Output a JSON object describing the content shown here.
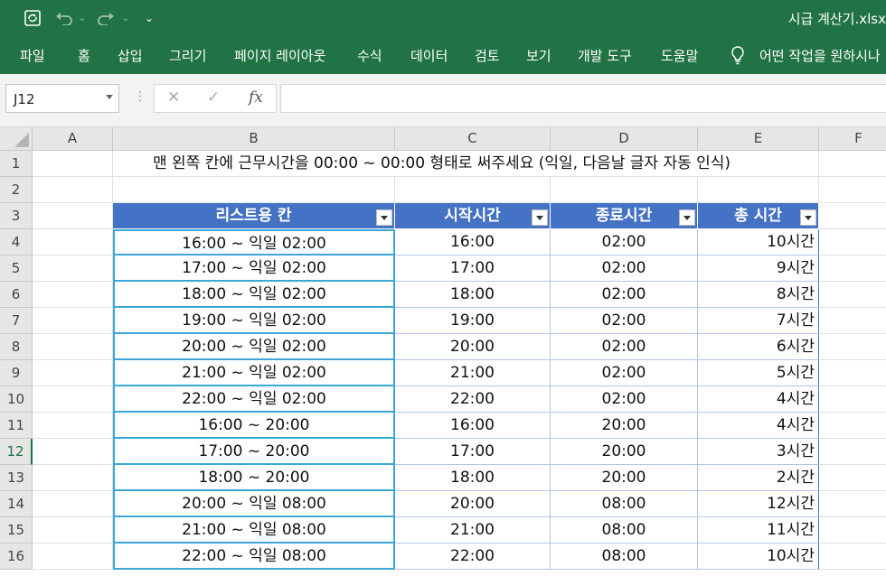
{
  "window": {
    "title": "시급 계산기.xlsx"
  },
  "quick_access": {
    "save_icon": "autosave-sync-icon",
    "undo_icon": "undo-icon",
    "redo_icon": "redo-icon",
    "customize_icon": "customize-qat-icon"
  },
  "ribbon": {
    "tabs": [
      "파일",
      "홈",
      "삽입",
      "그리기",
      "페이지 레이아웃",
      "수식",
      "데이터",
      "검토",
      "보기",
      "개발 도구",
      "도움말"
    ],
    "tell_me": "어떤 작업을 원하시나"
  },
  "formula_bar": {
    "name_box": "J12",
    "cancel_icon": "✕",
    "enter_icon": "✓",
    "fx_label": "fx",
    "formula": ""
  },
  "sheet": {
    "columns": [
      "A",
      "B",
      "C",
      "D",
      "E",
      "F"
    ],
    "rows": [
      "1",
      "2",
      "3",
      "4",
      "5",
      "6",
      "7",
      "8",
      "9",
      "10",
      "11",
      "12",
      "13",
      "14",
      "15",
      "16"
    ],
    "active_row": "12",
    "note": "맨 왼쪽 칸에 근무시간을 00:00 ~ 00:00 형태로 써주세요 (익일, 다음날 글자 자동 인식)",
    "table_headers": [
      "리스트용 칸",
      "시작시간",
      "종료시간",
      "총 시간"
    ],
    "table_header_color": "#4472c4",
    "selection_color": "#3aa7d8",
    "table_rows": [
      [
        "16:00 ~ 익일 02:00",
        "16:00",
        "02:00",
        "10시간"
      ],
      [
        "17:00 ~ 익일 02:00",
        "17:00",
        "02:00",
        "9시간"
      ],
      [
        "18:00 ~ 익일 02:00",
        "18:00",
        "02:00",
        "8시간"
      ],
      [
        "19:00 ~ 익일 02:00",
        "19:00",
        "02:00",
        "7시간"
      ],
      [
        "20:00 ~ 익일 02:00",
        "20:00",
        "02:00",
        "6시간"
      ],
      [
        "21:00 ~ 익일 02:00",
        "21:00",
        "02:00",
        "5시간"
      ],
      [
        "22:00 ~ 익일 02:00",
        "22:00",
        "02:00",
        "4시간"
      ],
      [
        "16:00 ~ 20:00",
        "16:00",
        "20:00",
        "4시간"
      ],
      [
        "17:00 ~ 20:00",
        "17:00",
        "20:00",
        "3시간"
      ],
      [
        "18:00 ~ 20:00",
        "18:00",
        "20:00",
        "2시간"
      ],
      [
        "20:00 ~ 익일 08:00",
        "20:00",
        "08:00",
        "12시간"
      ],
      [
        "21:00 ~ 익일 08:00",
        "21:00",
        "08:00",
        "11시간"
      ],
      [
        "22:00 ~ 익일 08:00",
        "22:00",
        "08:00",
        "10시간"
      ]
    ]
  }
}
